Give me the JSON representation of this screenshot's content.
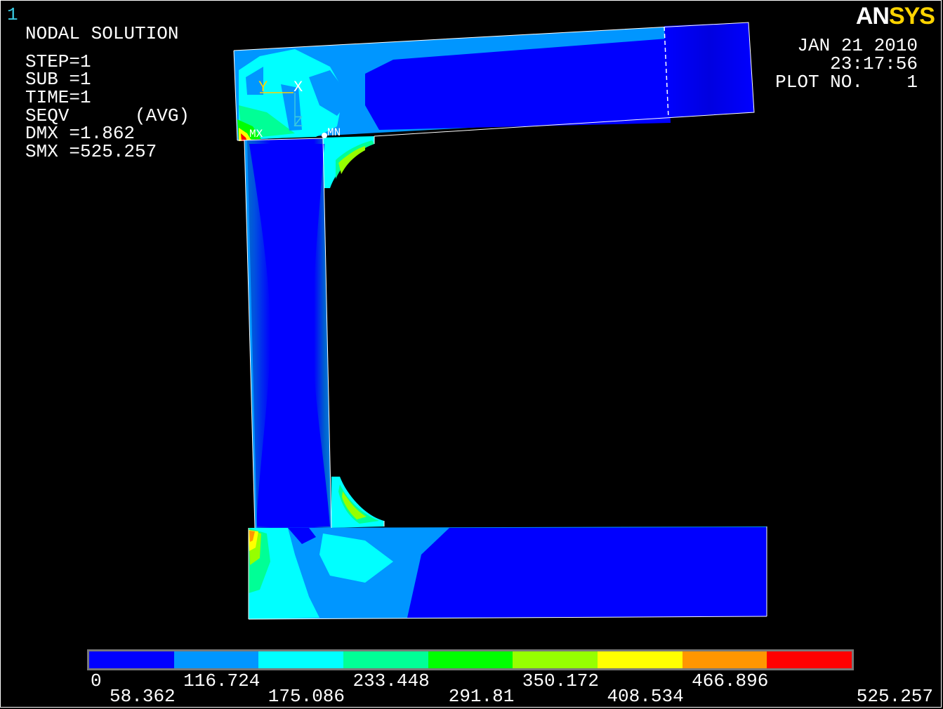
{
  "window_number": "1",
  "logo": {
    "part1": "AN",
    "part2": "SYS"
  },
  "info": {
    "title": "NODAL SOLUTION",
    "step": "STEP=1",
    "sub": "SUB =1",
    "time": "TIME=1",
    "seqv": "SEQV      (AVG)",
    "dmx": "DMX =1.862",
    "smx": "SMX =525.257"
  },
  "plot_meta": {
    "date": "JAN 21 2010",
    "time": "23:17:56",
    "plot_no": "PLOT NO.    1"
  },
  "triad": {
    "y": "Y",
    "x": "X",
    "z": "Z"
  },
  "markers": {
    "mx": "MX",
    "mn": "MN"
  },
  "legend": {
    "colors": [
      "#0000ff",
      "#0096ff",
      "#00ffff",
      "#00ff96",
      "#00ff00",
      "#96ff00",
      "#ffff00",
      "#ff9600",
      "#ff0000"
    ],
    "labels": [
      "0",
      "58.362",
      "116.724",
      "175.086",
      "233.448",
      "291.81",
      "350.172",
      "408.534",
      "466.896",
      "525.257"
    ]
  }
}
